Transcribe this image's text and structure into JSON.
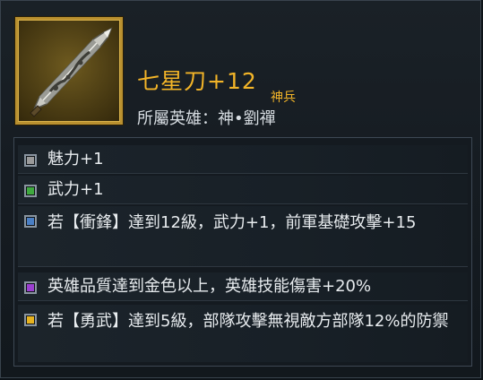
{
  "item": {
    "title": "七星刀+12",
    "grade": "神兵",
    "hero_line": "所屬英雄：神•劉禪",
    "icon": "sword-icon"
  },
  "effects": [
    {
      "text": "魅力+1",
      "color": "#9a9a9a"
    },
    {
      "text": "武力+1",
      "color": "#3fa93f"
    },
    {
      "text": "若【衝鋒】達到12級，武力+1，前軍基礎攻擊+15",
      "color": "#4a7fc4"
    },
    {
      "text": "英雄品質達到金色以上，英雄技能傷害+20%",
      "color": "#9b3fd0"
    },
    {
      "text": "若【勇武】達到5級，部隊攻擊無視敵方部隊12%的防禦",
      "color": "#e6b21f"
    }
  ]
}
